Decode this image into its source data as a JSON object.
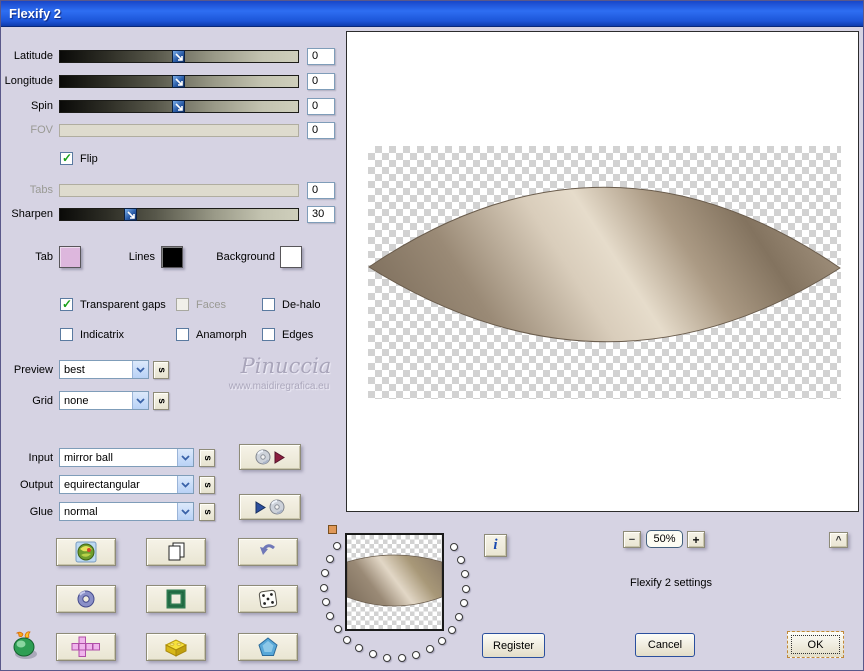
{
  "window": {
    "title": "Flexify 2"
  },
  "colors": {
    "titlebar_blue": "#2e6ef2",
    "dialog_background": "#d6d3e3",
    "button_face": "#efecdd",
    "combo_border": "#7f9db9",
    "tab_swatch": "#ddb7dd",
    "lines_swatch": "#000000",
    "background_swatch": "#ffffff",
    "image_tone_dark": "#7d6e5c",
    "image_tone_light": "#e6dccb"
  },
  "panel": {
    "sliders": [
      {
        "label": "Latitude",
        "value": "0",
        "percent": 50,
        "disabled": false
      },
      {
        "label": "Longitude",
        "value": "0",
        "percent": 50,
        "disabled": false
      },
      {
        "label": "Spin",
        "value": "0",
        "percent": 50,
        "disabled": false
      },
      {
        "label": "FOV",
        "value": "0",
        "percent": 50,
        "disabled": true
      },
      {
        "label": "Tabs",
        "value": "0",
        "percent": 50,
        "disabled": true
      },
      {
        "label": "Sharpen",
        "value": "30",
        "percent": 30,
        "disabled": false
      }
    ],
    "flip": {
      "label": "Flip",
      "checked": true
    },
    "swatches": {
      "tab": {
        "label": "Tab"
      },
      "lines": {
        "label": "Lines"
      },
      "background": {
        "label": "Background"
      }
    },
    "options": {
      "transparent_gaps": {
        "label": "Transparent gaps",
        "checked": true,
        "disabled": false
      },
      "faces": {
        "label": "Faces",
        "checked": false,
        "disabled": true
      },
      "dehalo": {
        "label": "De-halo",
        "checked": false,
        "disabled": false
      },
      "indicatrix": {
        "label": "Indicatrix",
        "checked": false,
        "disabled": false
      },
      "anamorph": {
        "label": "Anamorph",
        "checked": false,
        "disabled": false
      },
      "edges": {
        "label": "Edges",
        "checked": false,
        "disabled": false
      }
    },
    "selects": {
      "preview": {
        "label": "Preview",
        "value": "best"
      },
      "grid": {
        "label": "Grid",
        "value": "none"
      },
      "input": {
        "label": "Input",
        "value": "mirror ball"
      },
      "output": {
        "label": "Output",
        "value": "equirectangular"
      },
      "glue": {
        "label": "Glue",
        "value": "normal"
      }
    },
    "s_button_label": "s"
  },
  "watermark": {
    "line1": "Pinuccia",
    "line2": "www.maidiregrafica.eu"
  },
  "tool_icons": {
    "load_settings": "cd-play-icon",
    "save_settings": "play-cd-icon",
    "grid_row1": [
      "globe-photo-icon",
      "copy-pages-icon",
      "undo-arrow-icon"
    ],
    "grid_row2": [
      "torus-ring-icon",
      "square-frame-icon",
      "dice-icon"
    ],
    "grid_row3": [
      "cube-net-icon",
      "brick-icon",
      "pentagon-gem-icon"
    ],
    "logo": "flaming-pear-icon"
  },
  "footer": {
    "info_label": "i",
    "zoom": {
      "minus": "−",
      "level": "50%",
      "plus": "+"
    },
    "status": "Flexify 2 settings",
    "register_label": "Register",
    "cancel_label": "Cancel",
    "ok_label": "OK",
    "collapse_label": "^"
  }
}
